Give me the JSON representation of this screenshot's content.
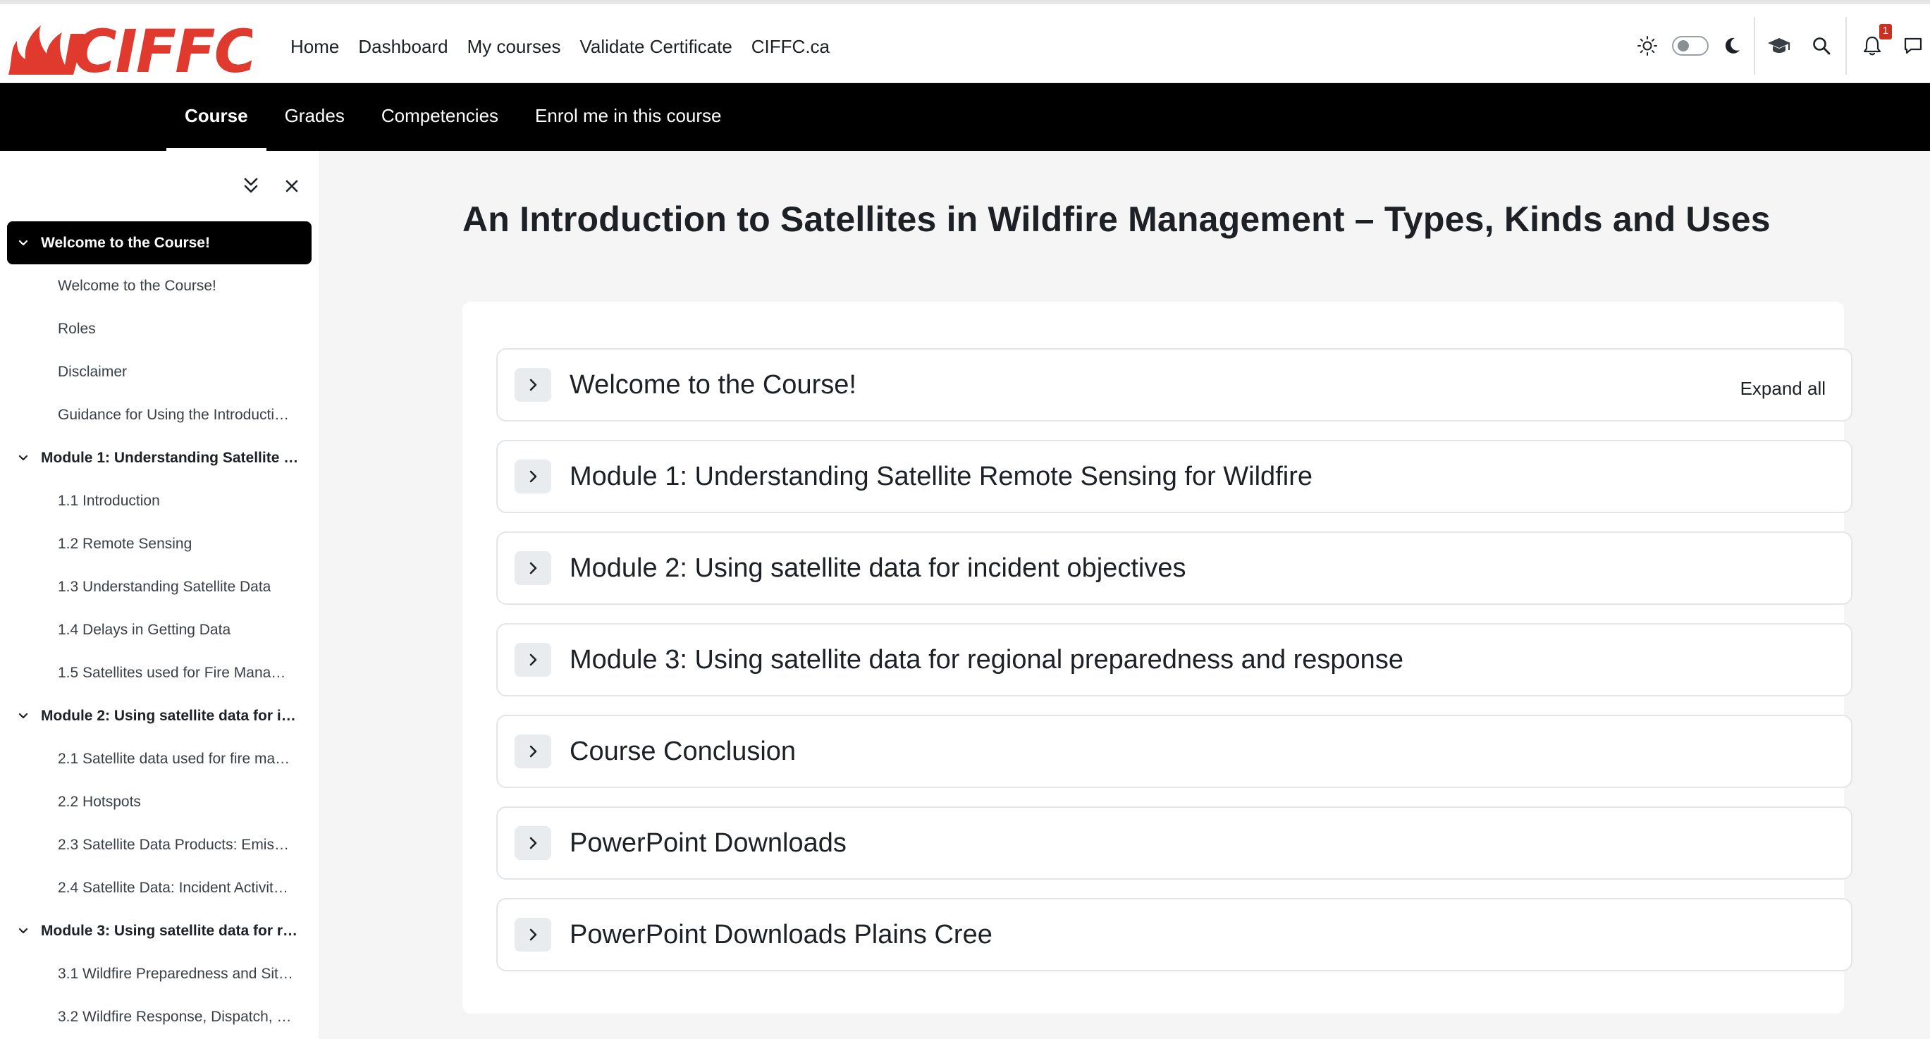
{
  "brand": {
    "logo_text": "CIFFC",
    "logo_color": "#e03a2f"
  },
  "primary_nav": [
    {
      "label": "Home"
    },
    {
      "label": "Dashboard"
    },
    {
      "label": "My courses"
    },
    {
      "label": "Validate Certificate"
    },
    {
      "label": "CIFFC.ca"
    }
  ],
  "tools": {
    "theme_light_icon": "sun-icon",
    "theme_dark_icon": "moon-icon",
    "courses_icon": "graduation-cap-icon",
    "search_icon": "search-icon",
    "notifications_icon": "bell-icon",
    "notification_count": "1",
    "messages_icon": "chat-icon"
  },
  "secondary_nav": {
    "tabs": [
      {
        "label": "Course",
        "active": true
      },
      {
        "label": "Grades"
      },
      {
        "label": "Competencies"
      },
      {
        "label": "Enrol me in this course"
      }
    ]
  },
  "course_index": {
    "items": [
      {
        "type": "section",
        "label": "Welcome to the Course!",
        "current": true
      },
      {
        "type": "activity",
        "label": "Welcome to the Course!"
      },
      {
        "type": "activity",
        "label": "Roles"
      },
      {
        "type": "activity",
        "label": "Disclaimer"
      },
      {
        "type": "activity",
        "label": "Guidance for Using the Introducti…"
      },
      {
        "type": "section",
        "label": "Module 1: Understanding Satellite …"
      },
      {
        "type": "activity",
        "label": "1.1 Introduction"
      },
      {
        "type": "activity",
        "label": "1.2 Remote Sensing"
      },
      {
        "type": "activity",
        "label": "1.3 Understanding Satellite Data"
      },
      {
        "type": "activity",
        "label": "1.4 Delays in Getting Data"
      },
      {
        "type": "activity",
        "label": "1.5 Satellites used for Fire Mana…"
      },
      {
        "type": "section",
        "label": "Module 2: Using satellite data for i…"
      },
      {
        "type": "activity",
        "label": "2.1 Satellite data used for fire ma…"
      },
      {
        "type": "activity",
        "label": "2.2 Hotspots"
      },
      {
        "type": "activity",
        "label": "2.3 Satellite Data Products: Emis…"
      },
      {
        "type": "activity",
        "label": "2.4 Satellite Data: Incident Activit…"
      },
      {
        "type": "section",
        "label": "Module 3: Using satellite data for r…"
      },
      {
        "type": "activity",
        "label": "3.1 Wildfire Preparedness and Sit…"
      },
      {
        "type": "activity",
        "label": "3.2 Wildfire Response, Dispatch, …"
      }
    ]
  },
  "main": {
    "title": "An Introduction to Satellites in Wildfire Management – Types, Kinds and Uses",
    "expand_all_label": "Expand all",
    "sections": [
      {
        "name": "Welcome to the Course!"
      },
      {
        "name": "Module 1: Understanding Satellite Remote Sensing for Wildfire"
      },
      {
        "name": "Module 2: Using satellite data for incident objectives"
      },
      {
        "name": "Module 3: Using satellite data for regional preparedness and response"
      },
      {
        "name": "Course Conclusion"
      },
      {
        "name": "PowerPoint Downloads"
      },
      {
        "name": "PowerPoint Downloads Plains Cree"
      }
    ]
  }
}
